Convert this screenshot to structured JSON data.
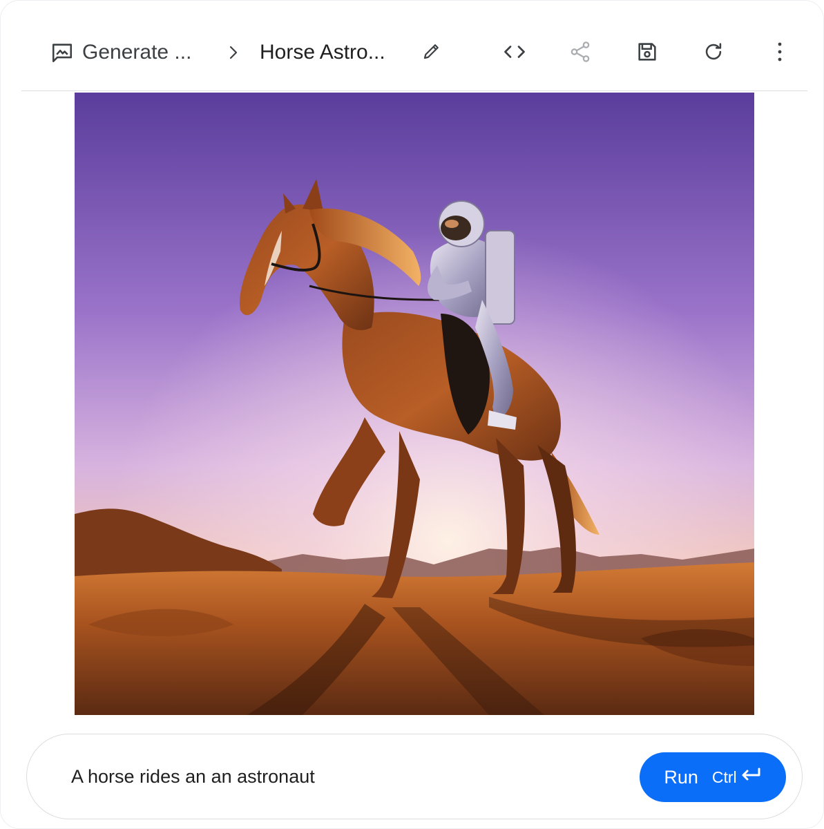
{
  "breadcrumb": {
    "app_icon": "image-prompt-icon",
    "app_label": "Generate ...",
    "separator_icon": "chevron-right-icon",
    "prompt_title": "Horse Astro...",
    "edit_icon": "pencil-icon"
  },
  "toolbar": {
    "code_icon": "code-icon",
    "share_icon": "share-icon",
    "save_icon": "save-icon",
    "refresh_icon": "refresh-icon",
    "more_icon": "more-vert-icon"
  },
  "image": {
    "description_icon": "generated-image"
  },
  "prompt": {
    "value": "A horse rides an an astronaut"
  },
  "run_button": {
    "label": "Run",
    "shortcut": "Ctrl",
    "shortcut_icon": "enter-key-icon",
    "color": "#0b6ef8"
  }
}
